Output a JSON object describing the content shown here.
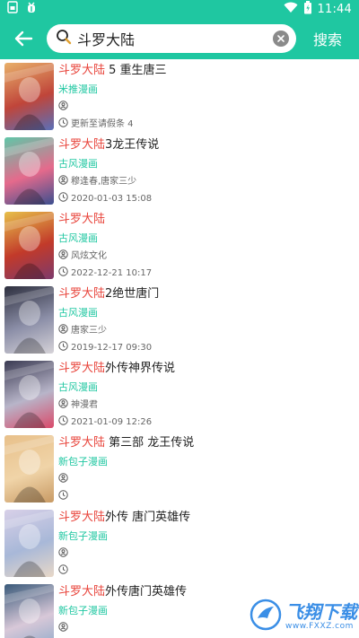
{
  "status_bar": {
    "time": "11:44",
    "icons": [
      "sim-card-icon",
      "bug-icon",
      "wifi-icon",
      "battery-icon"
    ]
  },
  "header": {
    "search_value": "斗罗大陆",
    "search_button_label": "搜索",
    "accent_color": "#1fc7a1"
  },
  "results": [
    {
      "title_highlight": "斗罗大陆",
      "title_rest": " 5 重生唐三",
      "source": "米推漫画",
      "author": "",
      "updated": "更新至请假条 4"
    },
    {
      "title_highlight": "斗罗大陆",
      "title_rest": "3龙王传说",
      "source": "古风漫画",
      "author": "穆逢春,唐家三少",
      "updated": "2020-01-03 15:08"
    },
    {
      "title_highlight": "斗罗大陆",
      "title_rest": "",
      "source": "古风漫画",
      "author": "风炫文化",
      "updated": "2022-12-21 10:17"
    },
    {
      "title_highlight": "斗罗大陆",
      "title_rest": "2绝世唐门",
      "source": "古风漫画",
      "author": "唐家三少",
      "updated": "2019-12-17 09:30"
    },
    {
      "title_highlight": "斗罗大陆",
      "title_rest": "外传神界传说",
      "source": "古风漫画",
      "author": "神漫君",
      "updated": "2021-01-09 12:26"
    },
    {
      "title_highlight": "斗罗大陆",
      "title_rest": " 第三部 龙王传说",
      "source": "新包子漫画",
      "author": "",
      "updated": ""
    },
    {
      "title_highlight": "斗罗大陆",
      "title_rest": "外传 唐门英雄传",
      "source": "新包子漫画",
      "author": "",
      "updated": ""
    },
    {
      "title_highlight": "斗罗大陆",
      "title_rest": "外传唐门英雄传",
      "source": "新包子漫画",
      "author": "",
      "updated": ""
    }
  ],
  "watermark": {
    "main": "飞翔下载",
    "sub": "www.FXXZ.com"
  }
}
